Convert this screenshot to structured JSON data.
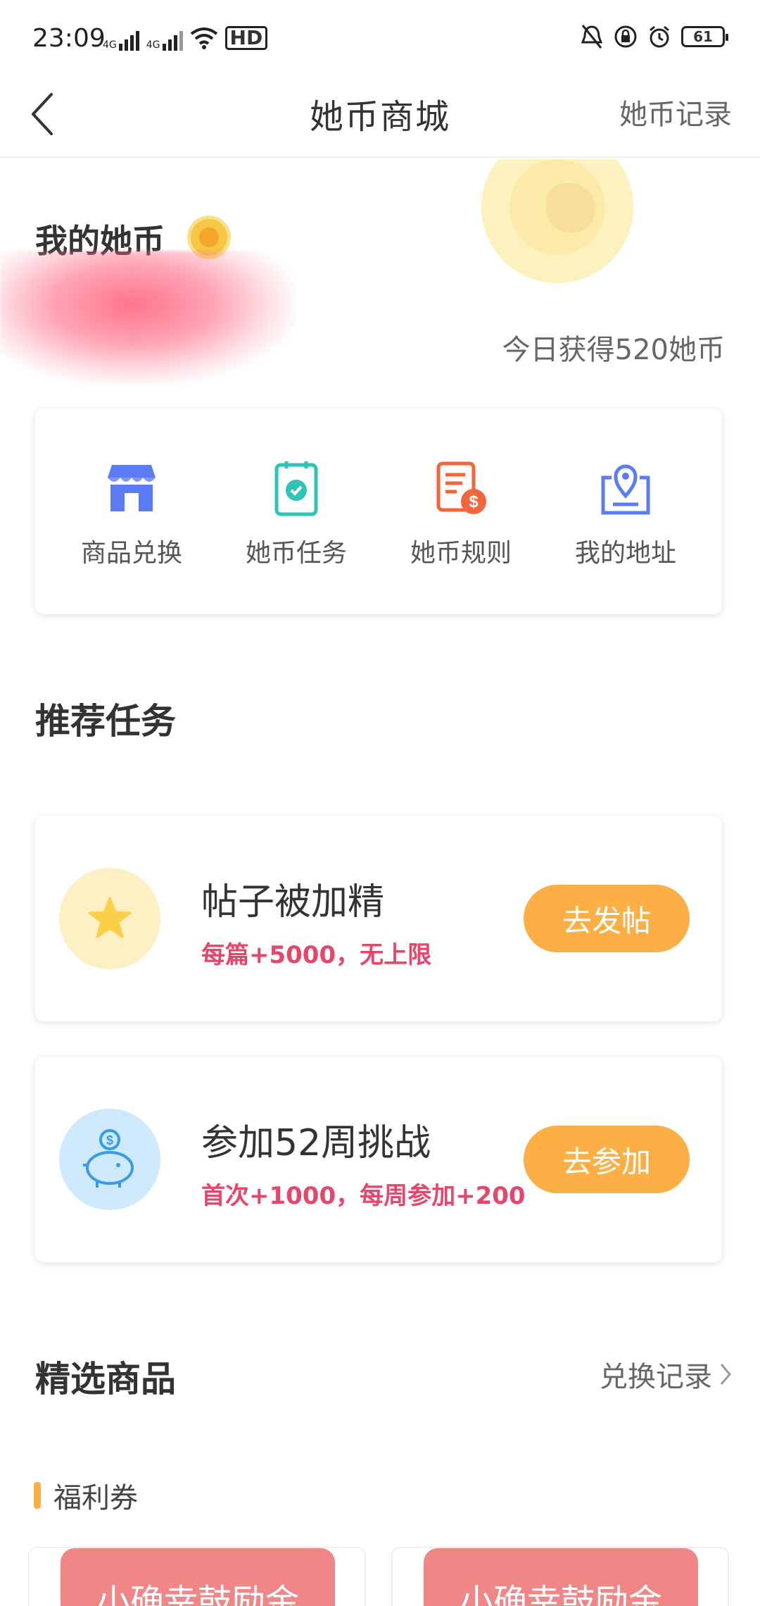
{
  "status_bar": {
    "time": "23:09",
    "network_1": "4G",
    "network_2": "4G",
    "hd_label": "HD",
    "battery": "61"
  },
  "nav": {
    "title": "她币商城",
    "right_link": "她币记录"
  },
  "coin_header": {
    "label": "我的她币",
    "today_earned": "今日获得520她币"
  },
  "actions": [
    {
      "label": "商品兑换",
      "icon": "store-icon",
      "color": "#5b7cf4"
    },
    {
      "label": "她币任务",
      "icon": "task-clipboard-icon",
      "color": "#2ec4b6"
    },
    {
      "label": "她币规则",
      "icon": "rules-document-icon",
      "color": "#f2663a"
    },
    {
      "label": "我的地址",
      "icon": "location-pin-icon",
      "color": "#5b7cf4"
    }
  ],
  "recommended": {
    "title": "推荐任务",
    "tasks": [
      {
        "title": "帖子被加精",
        "subtitle": "每篇+5000，无上限",
        "button": "去发帖",
        "icon": "star-icon",
        "icon_bg": "#fdf0c4"
      },
      {
        "title": "参加52周挑战",
        "subtitle": "首次+1000，每周参加+200",
        "button": "去参加",
        "icon": "piggy-bank-icon",
        "icon_bg": "#cfeafd"
      }
    ]
  },
  "featured": {
    "title": "精选商品",
    "link": "兑换记录",
    "category": "福利券",
    "products": [
      {
        "label": "小确幸鼓励金"
      },
      {
        "label": "小确幸鼓励金"
      }
    ]
  },
  "colors": {
    "accent_orange": "#fcaf45",
    "reward_red": "#e8456a",
    "coin_gold": "#f6c744"
  }
}
